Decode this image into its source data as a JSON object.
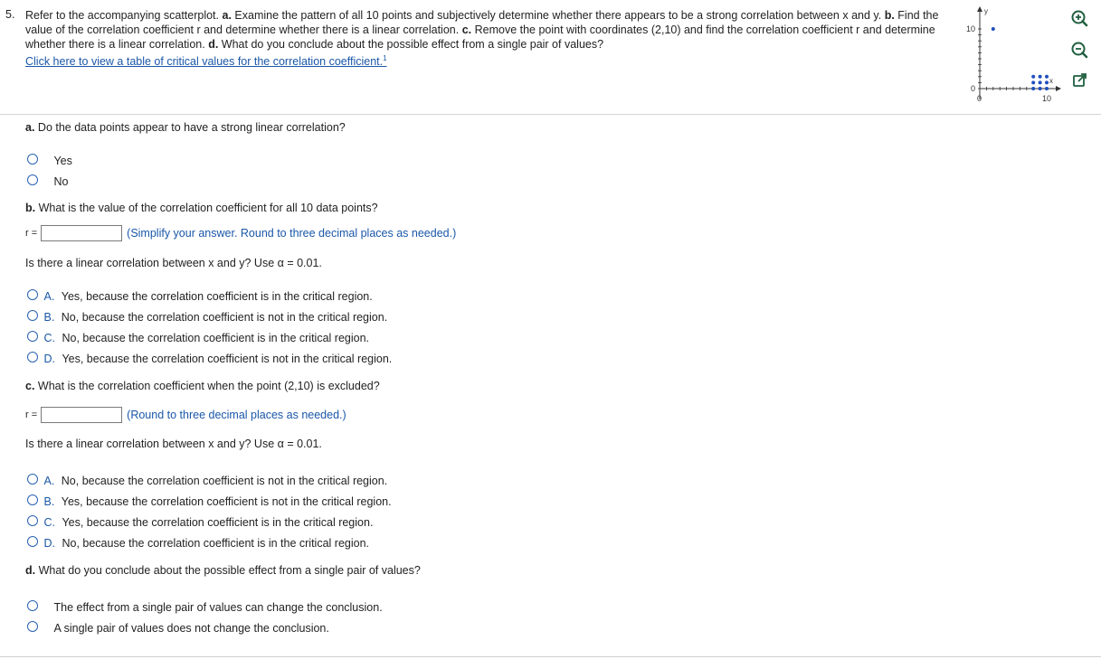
{
  "question": {
    "number": "5.",
    "intro": "Refer to the accompanying scatterplot.",
    "part_a_label": "a.",
    "part_a_text": "Examine the pattern of all 10 points and subjectively determine whether there appears to be a strong correlation between x and y.",
    "part_b_label": "b.",
    "part_b_text": "Find the value of the correlation coefficient r and determine whether there is a linear correlation.",
    "part_c_label": "c.",
    "part_c_text": "Remove the point with coordinates (2,10) and find the correlation coefficient r and determine whether there is a linear correlation.",
    "part_d_label": "d.",
    "part_d_text": "What do you conclude about the possible effect from a single pair of values?",
    "link_text": "Click here to view a table of critical values for the correlation coefficient.",
    "link_footnote": "1"
  },
  "thumbnail": {
    "y_axis_label": "y",
    "x_axis_label": "x",
    "y_tick_top": "10",
    "y_tick_zero": "0",
    "x_tick_zero": "0",
    "x_tick_ten": "10"
  },
  "chart_data": {
    "type": "scatter",
    "x_label": "x",
    "y_label": "y",
    "xlim": [
      0,
      10
    ],
    "ylim": [
      0,
      10
    ],
    "x": [
      2,
      8,
      8,
      8,
      9,
      9,
      9,
      10,
      10,
      10
    ],
    "y": [
      10,
      2,
      1,
      0,
      2,
      1,
      0,
      2,
      1,
      0
    ],
    "point_color": "#1f4fbf"
  },
  "tools": {
    "zoom_in": "zoom-in-icon",
    "zoom_out": "zoom-out-icon",
    "popout": "popout-icon"
  },
  "part_a": {
    "prompt_label": "a.",
    "prompt": "Do the data points appear to have a strong linear correlation?",
    "options": [
      "Yes",
      "No"
    ]
  },
  "part_b": {
    "prompt_label": "b.",
    "prompt": "What is the value of the correlation coefficient for all 10 data points?",
    "r_label": "r =",
    "r_value": "",
    "hint": "(Simplify your answer. Round to three decimal places as needed.)",
    "linear_question": "Is there a linear correlation between x and y? Use α = 0.01.",
    "options": [
      {
        "letter": "A.",
        "text": "Yes, because the correlation coefficient is in the critical region."
      },
      {
        "letter": "B.",
        "text": "No, because the correlation coefficient is not in the critical region."
      },
      {
        "letter": "C.",
        "text": "No, because the correlation coefficient is in the critical region."
      },
      {
        "letter": "D.",
        "text": "Yes, because the correlation coefficient is not in the critical region."
      }
    ]
  },
  "part_c": {
    "prompt_label": "c.",
    "prompt": "What is the correlation coefficient when the point (2,10) is excluded?",
    "r_label": "r =",
    "r_value": "",
    "hint": "(Round to three decimal places as needed.)",
    "linear_question": "Is there a linear correlation between x and y? Use α = 0.01.",
    "options": [
      {
        "letter": "A.",
        "text": "No, because the correlation coefficient is not in the critical region."
      },
      {
        "letter": "B.",
        "text": "Yes, because the correlation coefficient is not in the critical region."
      },
      {
        "letter": "C.",
        "text": "Yes, because the correlation coefficient is in the critical region."
      },
      {
        "letter": "D.",
        "text": "No, because the correlation coefficient is in the critical region."
      }
    ]
  },
  "part_d": {
    "prompt_label": "d.",
    "prompt": "What do you conclude about the possible effect from a single pair of values?",
    "options": [
      "The effect from a single pair of values can change the conclusion.",
      "A single pair of values does not change the conclusion."
    ]
  }
}
